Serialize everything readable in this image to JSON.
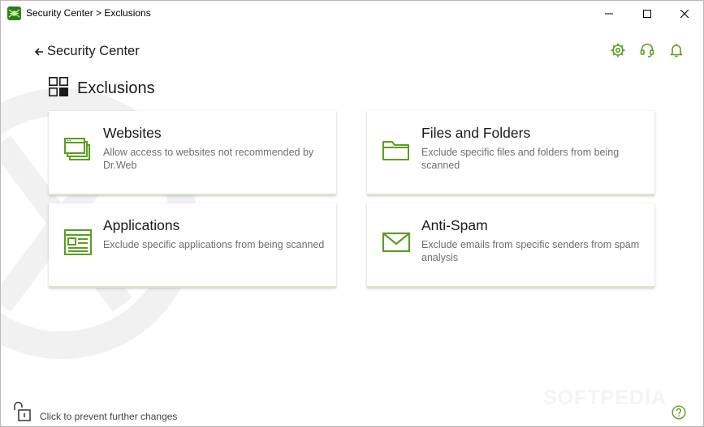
{
  "window": {
    "title": "Security Center > Exclusions"
  },
  "nav": {
    "back_label": "Security Center"
  },
  "page": {
    "title": "Exclusions"
  },
  "cards": [
    {
      "icon": "websites-icon",
      "title": "Websites",
      "description": "Allow access to websites not recommended by Dr.Web"
    },
    {
      "icon": "folder-icon",
      "title": "Files and Folders",
      "description": "Exclude specific files and folders from being scanned"
    },
    {
      "icon": "application-window-icon",
      "title": "Applications",
      "description": "Exclude specific applications from being scanned"
    },
    {
      "icon": "envelope-icon",
      "title": "Anti-Spam",
      "description": "Exclude emails from specific senders from spam analysis"
    }
  ],
  "footer": {
    "lock_text": "Click to prevent further changes"
  },
  "watermark": "SOFTPEDIA",
  "colors": {
    "accent": "#5a9e1f",
    "text": "#1a1a1a",
    "muted": "#6e6e6e"
  }
}
